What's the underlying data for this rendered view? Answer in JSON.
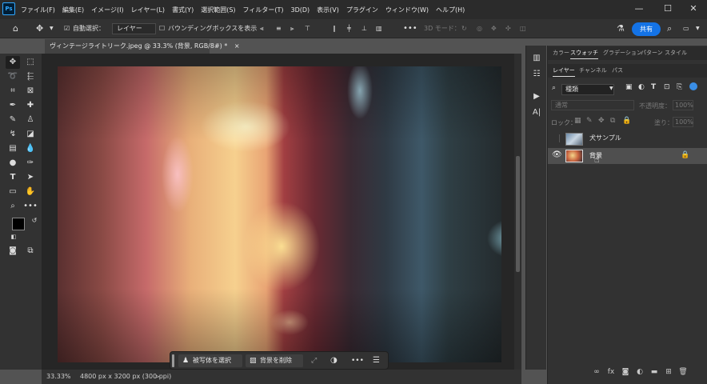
{
  "app": {
    "logo": "Ps"
  },
  "menu": [
    "ファイル(F)",
    "編集(E)",
    "イメージ(I)",
    "レイヤー(L)",
    "書式(Y)",
    "選択範囲(S)",
    "フィルター(T)",
    "3D(D)",
    "表示(V)",
    "プラグイン",
    "ウィンドウ(W)",
    "ヘルプ(H)"
  ],
  "window_controls": {
    "minimize": "—",
    "maximize": "☐",
    "close": "✕"
  },
  "options": {
    "auto_select_label": "自動選択：",
    "auto_select_value": "レイヤー",
    "bounding_box_label": "バウンディングボックスを表示",
    "mode_3d_label": "3D モード：",
    "more": "•••",
    "share_label": "共有"
  },
  "document": {
    "tab_title": "ヴィンテージライトリーク.jpeg @ 33.3% (背景, RGB/8#) *",
    "close": "×"
  },
  "taskbar": {
    "select_subject": "被写体を選択",
    "remove_background": "背景を削除",
    "more": "•••"
  },
  "status": {
    "zoom": "33.33%",
    "doc_size": "4800 px x 3200 px (300 ppi)"
  },
  "panels": {
    "top_tabs": [
      "カラー",
      "スウォッチ",
      "グラデーション",
      "パターン",
      "スタイル"
    ],
    "top_tab_active": "スウォッチ",
    "layer_tabs": [
      "レイヤー",
      "チャンネル",
      "パス"
    ],
    "layer_tab_active": "レイヤー",
    "filter_label": "種類",
    "blend_mode": "通常",
    "opacity_label": "不透明度：",
    "opacity_value": "100%",
    "lock_label": "ロック：",
    "fill_label": "塗り：",
    "fill_value": "100%",
    "layers": [
      {
        "name": "犬サンプル",
        "visible": false,
        "selected": false,
        "locked": false
      },
      {
        "name": "背景",
        "visible": true,
        "selected": true,
        "locked": true
      }
    ]
  },
  "colors": {
    "accent": "#1473e6",
    "foreground": "#000000",
    "background": "#b4e1f5"
  }
}
